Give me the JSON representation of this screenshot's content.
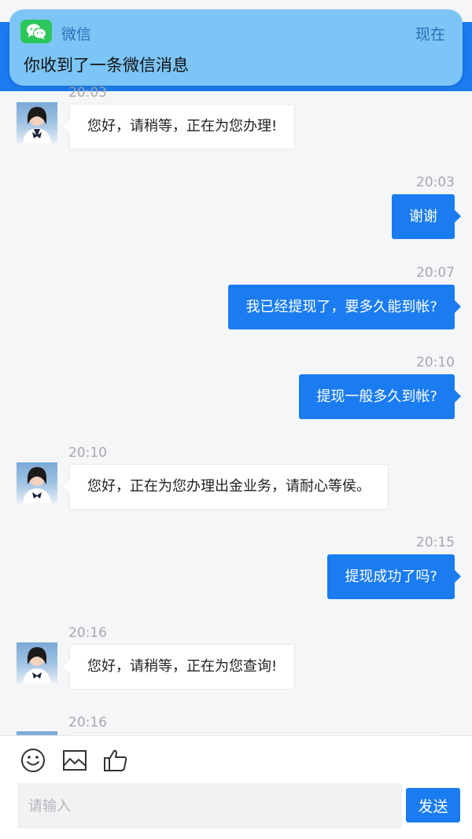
{
  "notification": {
    "app_name": "微信",
    "time": "现在",
    "message": "你收到了一条微信消息",
    "app_icon": "wechat-icon",
    "accent": "#2dc65a"
  },
  "colors": {
    "primary": "#1a7cf0",
    "background": "#f5f6f8"
  },
  "messages": [
    {
      "time": "20:03",
      "from": "agent",
      "text": "您好，请稍等，正在为您办理!"
    },
    {
      "time": "20:03",
      "from": "user",
      "text": "谢谢"
    },
    {
      "time": "20:07",
      "from": "user",
      "text": "我已经提现了，要多久能到帐?"
    },
    {
      "time": "20:10",
      "from": "user",
      "text": "提现一般多久到帐?"
    },
    {
      "time": "20:10",
      "from": "agent",
      "text": "您好，正在为您办理出金业务，请耐心等侯。"
    },
    {
      "time": "20:15",
      "from": "user",
      "text": "提现成功了吗?"
    },
    {
      "time": "20:16",
      "from": "agent",
      "text": "您好，请稍等，正在为您查询!"
    },
    {
      "time": "20:16",
      "from": "agent",
      "text": ""
    }
  ],
  "toolbar": {
    "emoji_icon": "emoji-icon",
    "image_icon": "image-icon",
    "like_icon": "thumbs-up-icon"
  },
  "input": {
    "placeholder": "请输入",
    "value": ""
  },
  "send_label": "发送"
}
